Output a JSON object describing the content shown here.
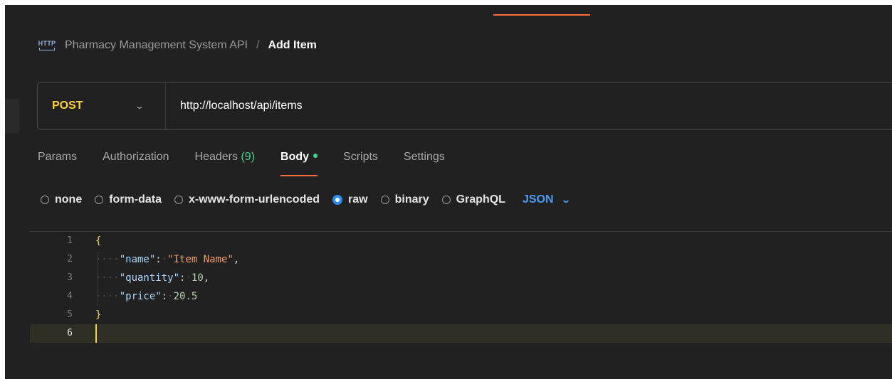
{
  "breadcrumb": {
    "icon": "http-icon",
    "icon_text": "HTTP",
    "collection": "Pharmacy Management System API",
    "separator": "/",
    "request": "Add Item"
  },
  "request": {
    "method": "POST",
    "url": "http://localhost/api/items"
  },
  "tabs": [
    {
      "label": "Params"
    },
    {
      "label": "Authorization"
    },
    {
      "label": "Headers",
      "count": "(9)"
    },
    {
      "label": "Body",
      "active": true,
      "indicator": "green-dot"
    },
    {
      "label": "Scripts"
    },
    {
      "label": "Settings"
    }
  ],
  "body_types": [
    {
      "label": "none",
      "checked": false
    },
    {
      "label": "form-data",
      "checked": false
    },
    {
      "label": "x-www-form-urlencoded",
      "checked": false
    },
    {
      "label": "raw",
      "checked": true
    },
    {
      "label": "binary",
      "checked": false
    },
    {
      "label": "GraphQL",
      "checked": false
    }
  ],
  "body_language": "JSON",
  "editor": {
    "line_numbers": [
      "1",
      "2",
      "3",
      "4",
      "5",
      "6"
    ],
    "lines": [
      {
        "brace": "{"
      },
      {
        "key": "\"name\"",
        "colon": ":",
        "string": "\"Item Name\"",
        "comma": ","
      },
      {
        "key": "\"quantity\"",
        "colon": ":",
        "number": "10",
        "comma": ","
      },
      {
        "key": "\"price\"",
        "colon": ":",
        "number": "20.5"
      },
      {
        "brace": "}"
      },
      {}
    ],
    "active_line": 6
  },
  "colors": {
    "background": "#212121",
    "accent": "#ff6c37",
    "method": "#ffd33d",
    "success": "#3dd68c",
    "link": "#4a9df8"
  }
}
